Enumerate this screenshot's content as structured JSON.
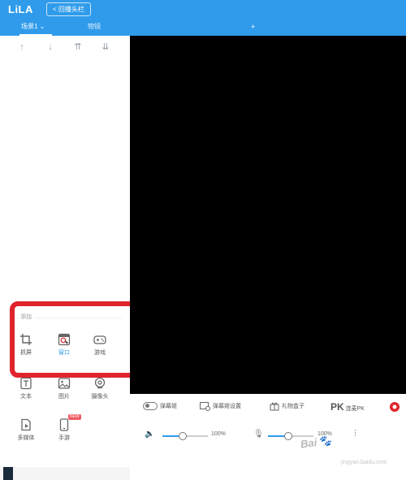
{
  "app": {
    "logo_text": "LiLA"
  },
  "header": {
    "back_button_label": "< 回播头栏"
  },
  "tabs": {
    "scene_label": "场景1 ⌄",
    "material_label": "物镜",
    "add_label": "+"
  },
  "sort_buttons": [
    {
      "icon": "arrow-up-icon",
      "glyph": "↑"
    },
    {
      "icon": "arrow-down-icon",
      "glyph": "↓"
    },
    {
      "icon": "move-top-icon",
      "glyph": "⇈"
    },
    {
      "icon": "move-bottom-icon",
      "glyph": "⇊"
    }
  ],
  "add_source": {
    "header": "添加",
    "buttons": [
      {
        "name": "screen-capture",
        "label": "抓屏",
        "active": false
      },
      {
        "name": "window",
        "label": "窗口",
        "active": true
      },
      {
        "name": "game",
        "label": "游戏",
        "active": false
      },
      {
        "name": "text",
        "label": "文本",
        "active": false
      },
      {
        "name": "image",
        "label": "图片",
        "active": false
      },
      {
        "name": "camera",
        "label": "摄像头",
        "active": false
      },
      {
        "name": "multimedia",
        "label": "多媒体",
        "active": false
      },
      {
        "name": "mobile-game",
        "label": "手游",
        "active": false,
        "badge": "NEW"
      }
    ]
  },
  "toolbar": {
    "danmu_label": "弹幕姬",
    "danmu_settings_label": "弹幕姬设置",
    "gift_box_label": "礼物盒子",
    "pk_icon_text": "PK",
    "pk_label": "连麦PK"
  },
  "volume": {
    "speaker_value_label": "100%",
    "speaker_value": 0.45,
    "mic_value_label": "100%",
    "mic_value": 0.45
  },
  "watermark": {
    "text": "Bai",
    "sub": "jingyan.baidu.com"
  },
  "colors": {
    "topbar": "#2f9bea",
    "highlight": "#e0242c",
    "accent": "#2f9bea",
    "preview_bg": "#000000"
  }
}
